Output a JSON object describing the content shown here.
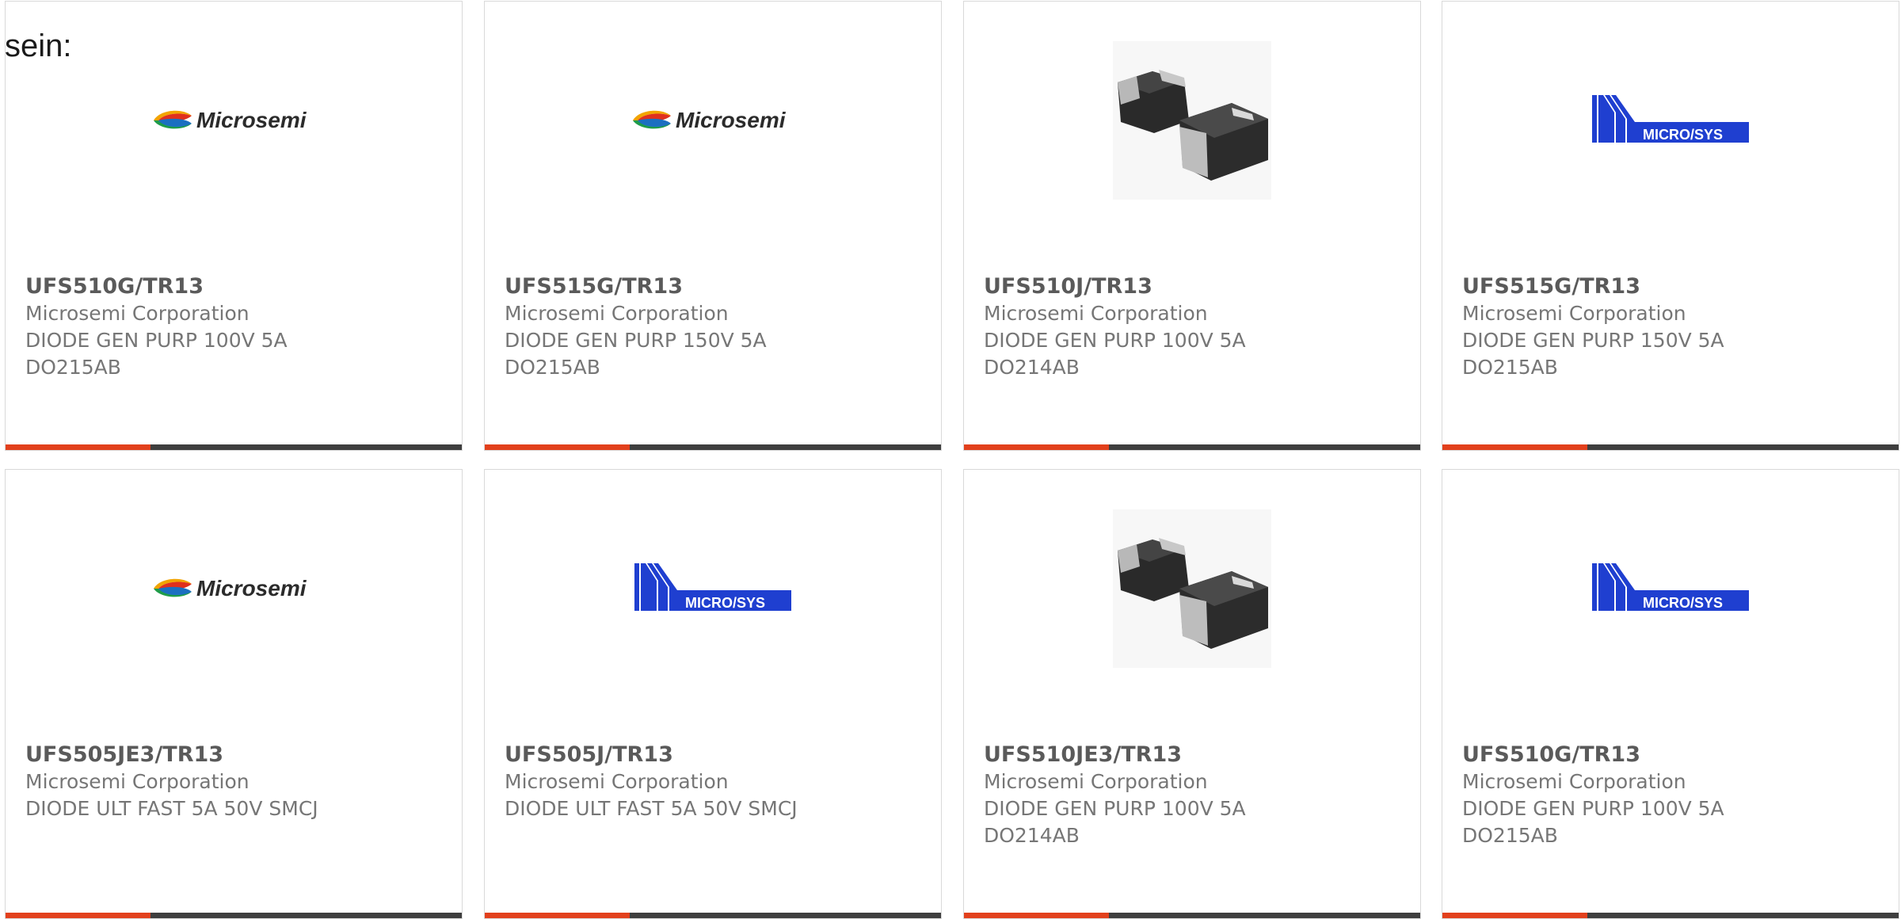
{
  "intro_text": "sein:",
  "colors": {
    "accent": "#e2401c",
    "bar": "#3e3e3e",
    "text_primary": "#5a5a5a",
    "text_secondary": "#767676",
    "microsys_blue": "#1f3fd0"
  },
  "products": [
    {
      "part_number": "UFS510G/TR13",
      "manufacturer": "Microsemi Corporation",
      "description": "DIODE GEN PURP 100V 5A DO215AB",
      "image": "microsemi-logo",
      "logo_text": "Microsemi"
    },
    {
      "part_number": "UFS515G/TR13",
      "manufacturer": "Microsemi Corporation",
      "description": "DIODE GEN PURP 150V 5A DO215AB",
      "image": "microsemi-logo",
      "logo_text": "Microsemi"
    },
    {
      "part_number": "UFS510J/TR13",
      "manufacturer": "Microsemi Corporation",
      "description": "DIODE GEN PURP 100V 5A DO214AB",
      "image": "diode-package-photo",
      "logo_text": ""
    },
    {
      "part_number": "UFS515G/TR13",
      "manufacturer": "Microsemi Corporation",
      "description": "DIODE GEN PURP 150V 5A DO215AB",
      "image": "microsys-logo",
      "logo_text": "MICRO/SYS"
    },
    {
      "part_number": "UFS505JE3/TR13",
      "manufacturer": "Microsemi Corporation",
      "description": "DIODE ULT FAST 5A 50V SMCJ",
      "image": "microsemi-logo",
      "logo_text": "Microsemi"
    },
    {
      "part_number": "UFS505J/TR13",
      "manufacturer": "Microsemi Corporation",
      "description": "DIODE ULT FAST 5A 50V SMCJ",
      "image": "microsys-logo",
      "logo_text": "MICRO/SYS"
    },
    {
      "part_number": "UFS510JE3/TR13",
      "manufacturer": "Microsemi Corporation",
      "description": "DIODE GEN PURP 100V 5A DO214AB",
      "image": "diode-package-photo",
      "logo_text": ""
    },
    {
      "part_number": "UFS510G/TR13",
      "manufacturer": "Microsemi Corporation",
      "description": "DIODE GEN PURP 100V 5A DO215AB",
      "image": "microsys-logo",
      "logo_text": "MICRO/SYS"
    }
  ]
}
